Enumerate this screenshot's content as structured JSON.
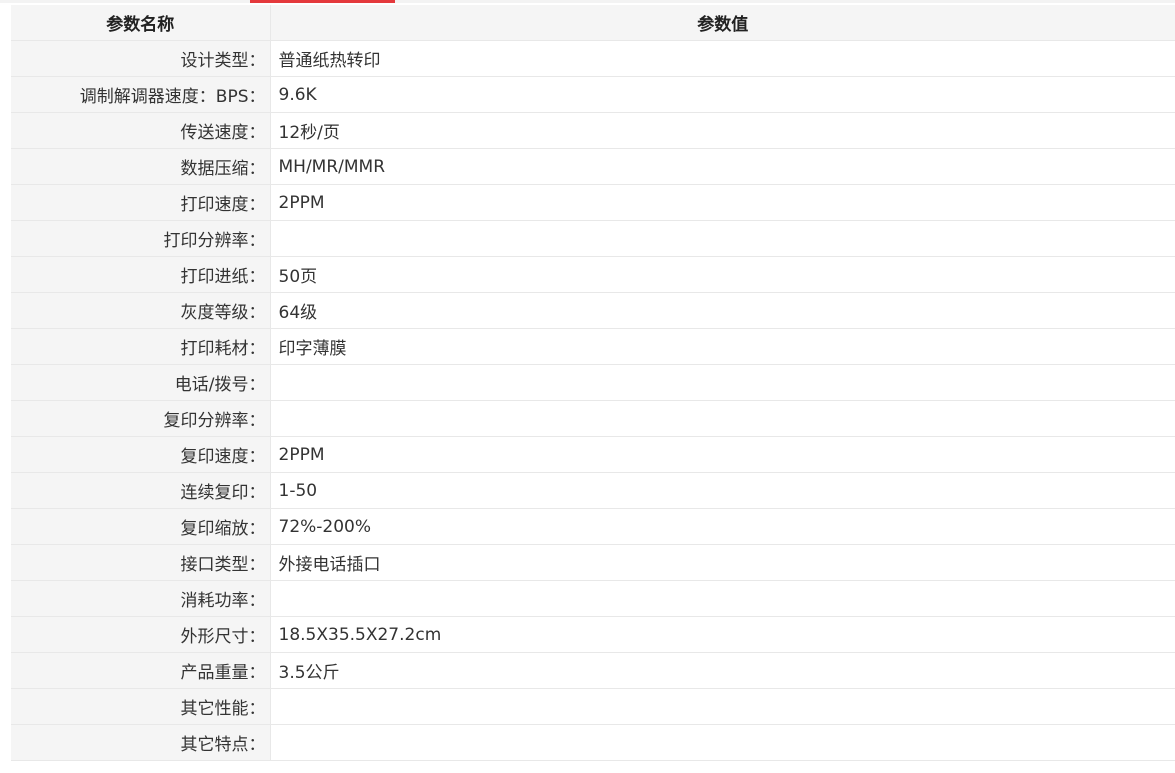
{
  "table": {
    "header": {
      "name": "参数名称",
      "value": "参数值"
    },
    "rows": [
      {
        "name": "设计类型：",
        "value": "普通纸热转印"
      },
      {
        "name": "调制解调器速度：BPS：",
        "value": "9.6K"
      },
      {
        "name": "传送速度：",
        "value": "12秒/页"
      },
      {
        "name": "数据压缩：",
        "value": "MH/MR/MMR"
      },
      {
        "name": "打印速度：",
        "value": "2PPM"
      },
      {
        "name": "打印分辨率：",
        "value": ""
      },
      {
        "name": "打印进纸：",
        "value": "50页"
      },
      {
        "name": "灰度等级：",
        "value": "64级"
      },
      {
        "name": "打印耗材：",
        "value": "印字薄膜"
      },
      {
        "name": "电话/拨号：",
        "value": ""
      },
      {
        "name": "复印分辨率：",
        "value": ""
      },
      {
        "name": "复印速度：",
        "value": "2PPM"
      },
      {
        "name": "连续复印：",
        "value": "1-50"
      },
      {
        "name": "复印缩放：",
        "value": "72%-200%"
      },
      {
        "name": "接口类型：",
        "value": "外接电话插口"
      },
      {
        "name": "消耗功率：",
        "value": ""
      },
      {
        "name": "外形尺寸：",
        "value": "18.5X35.5X27.2cm"
      },
      {
        "name": "产品重量：",
        "value": "3.5公斤"
      },
      {
        "name": "其它性能：",
        "value": ""
      },
      {
        "name": "其它特点：",
        "value": ""
      }
    ]
  },
  "colors": {
    "accent": "#e4393c",
    "label_bg": "#f5f5f5",
    "border": "#e8e8e8"
  }
}
